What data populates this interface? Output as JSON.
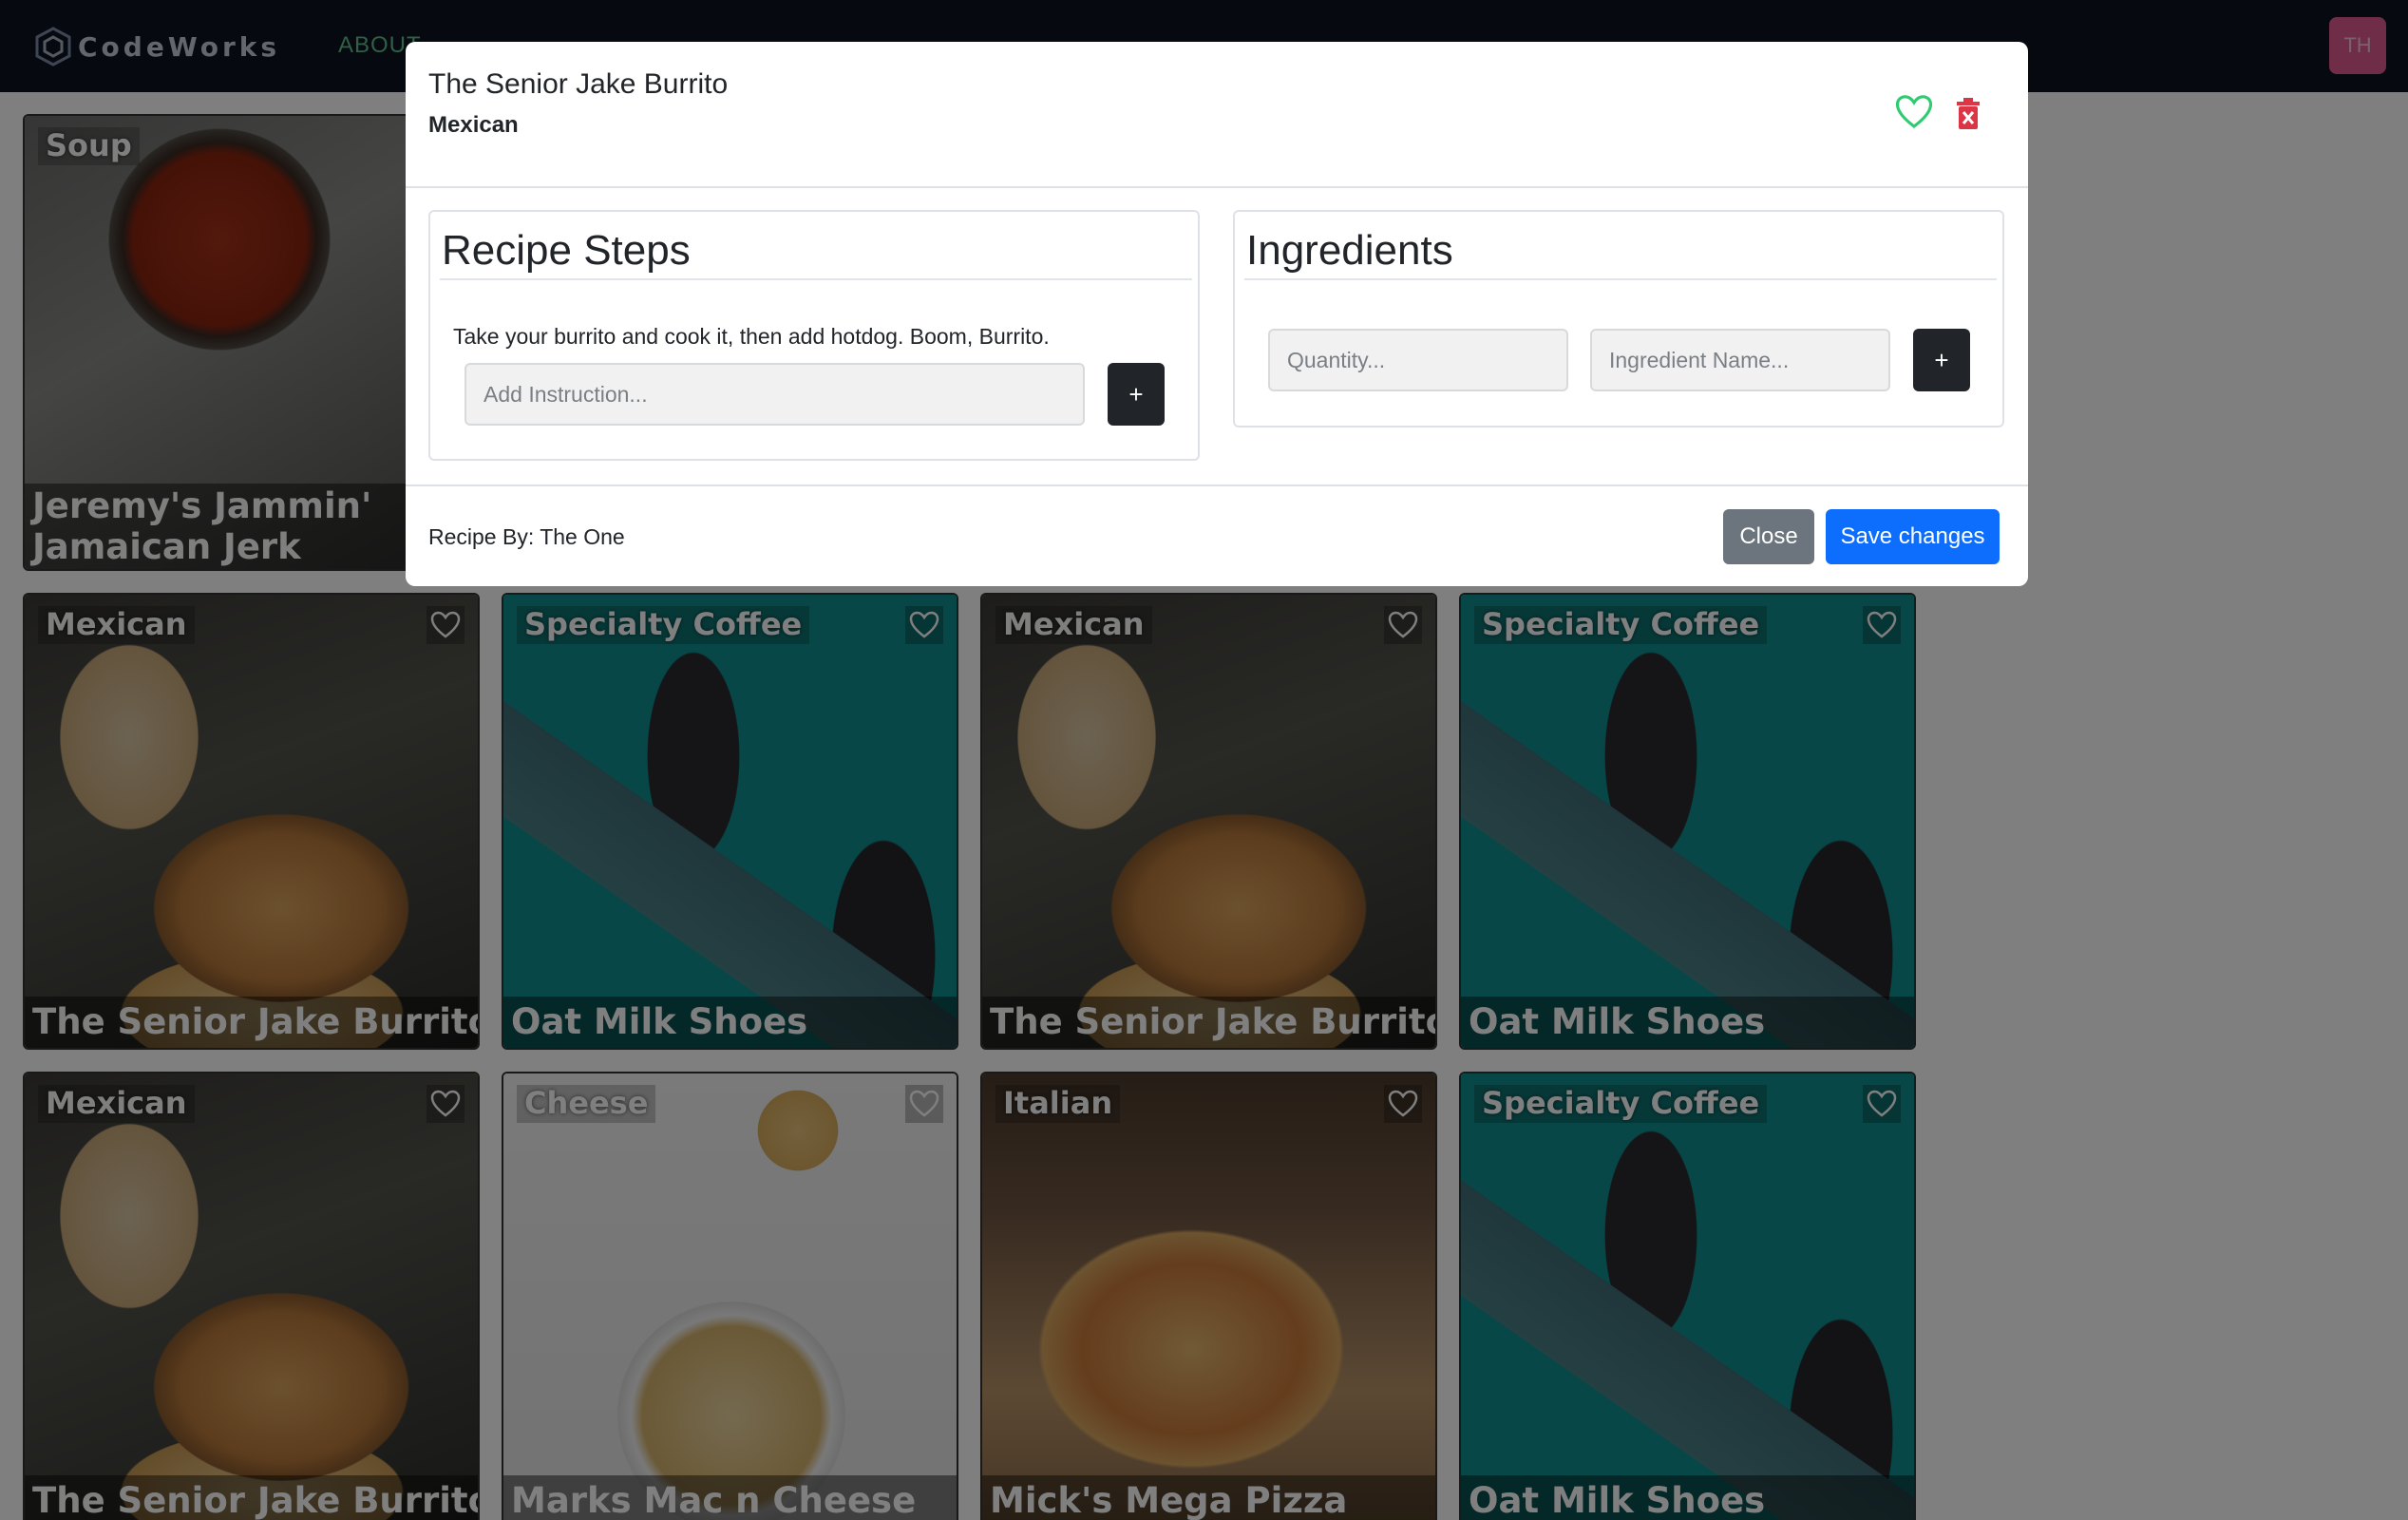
{
  "navbar": {
    "brand": "CodeWorks",
    "about": "ABOUT",
    "avatar_initials": "TH"
  },
  "cards": [
    {
      "category": "Soup",
      "title": "Jeremy's Jammin' Jamaican Jerk Jumbalaya",
      "image": "soup"
    },
    {
      "category": "Mexican",
      "title": "The Senior Jake Burrito",
      "image": "burrito"
    },
    {
      "category": "Specialty Coffee",
      "title": "Oat Milk Shoes",
      "image": "shoes"
    },
    {
      "category": "Mexican",
      "title": "The Senior Jake Burrito",
      "image": "burrito"
    },
    {
      "category": "Specialty Coffee",
      "title": "Oat Milk Shoes",
      "image": "shoes"
    },
    {
      "category": "Mexican",
      "title": "The Senior Jake Burrito",
      "image": "burrito"
    },
    {
      "category": "Cheese",
      "title": "Marks Mac n Cheese",
      "image": "mac"
    },
    {
      "category": "Italian",
      "title": "Mick's Mega Pizza",
      "image": "pizza"
    },
    {
      "category": "Specialty Coffee",
      "title": "Oat Milk Shoes",
      "image": "shoes"
    }
  ],
  "modal": {
    "title": "The Senior Jake Burrito",
    "category": "Mexican",
    "steps_heading": "Recipe Steps",
    "step_text": "Take your burrito and cook it, then add hotdog. Boom, Burrito.",
    "instruction_placeholder": "Add Instruction...",
    "ingredients_heading": "Ingredients",
    "quantity_placeholder": "Quantity...",
    "ingredient_placeholder": "Ingredient Name...",
    "plus_label": "+",
    "recipe_by": "Recipe By: The One",
    "close_label": "Close",
    "save_label": "Save changes"
  },
  "colors": {
    "navbar_bg": "#0d1421",
    "heart_green": "#2ecc71",
    "trash_red": "#dc3545",
    "save_blue": "#0d6efd",
    "close_gray": "#6c757d"
  },
  "icons": [
    "heart-icon",
    "trash-icon",
    "codeworks-logo-icon"
  ]
}
